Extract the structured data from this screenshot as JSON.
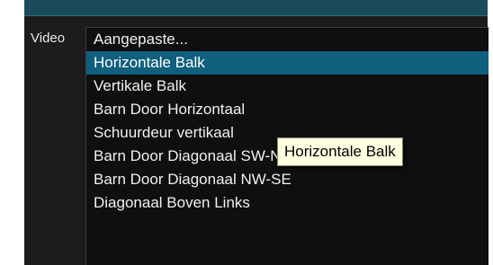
{
  "section": {
    "label": "Video"
  },
  "transition_list": {
    "items": [
      {
        "label": "Aangepaste...",
        "selected": false
      },
      {
        "label": "Horizontale Balk",
        "selected": true
      },
      {
        "label": "Vertikale Balk",
        "selected": false
      },
      {
        "label": "Barn Door Horizontaal",
        "selected": false
      },
      {
        "label": "Schuurdeur vertikaal",
        "selected": false
      },
      {
        "label": "Barn Door Diagonaal SW-NE",
        "selected": false
      },
      {
        "label": "Barn Door Diagonaal NW-SE",
        "selected": false
      },
      {
        "label": "Diagonaal Boven Links",
        "selected": false
      }
    ]
  },
  "tooltip": {
    "text": "Horizontale Balk"
  },
  "colors": {
    "selection": "#0f5f7d",
    "list_background": "#0f0f0f",
    "tooltip_background": "#ffffe1",
    "top_band": "#1b4b5a"
  }
}
